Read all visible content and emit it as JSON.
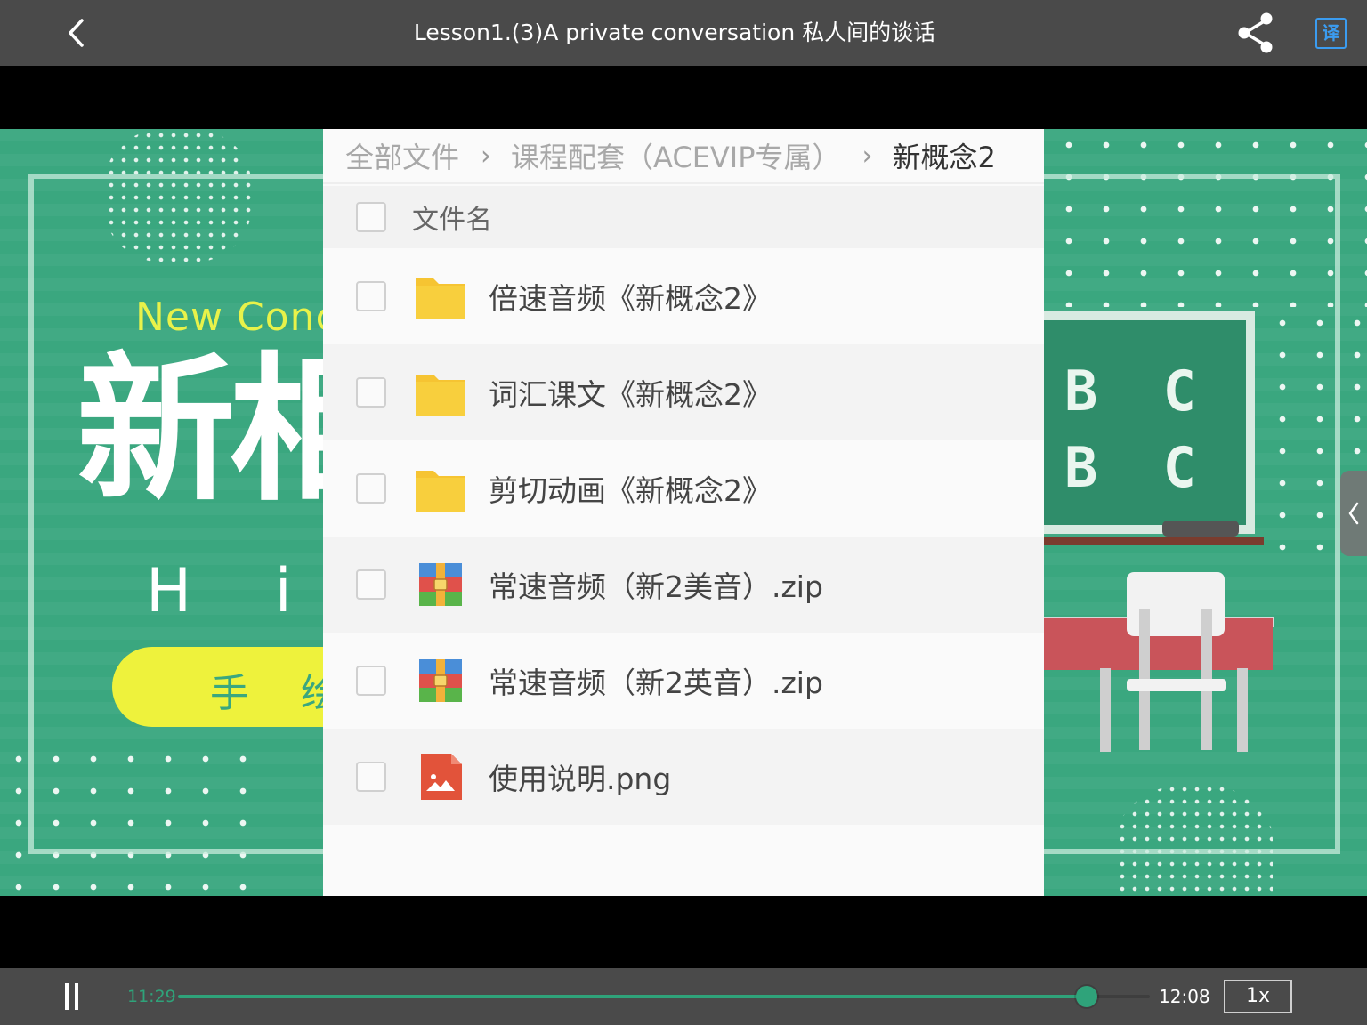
{
  "topbar": {
    "title": "Lesson1.(3)A private conversation 私人间的谈话",
    "back_icon": "chevron-left-icon",
    "share_icon": "share-icon",
    "translate_label": "译"
  },
  "video": {
    "background_color": "#3aa77f",
    "slide_left": {
      "subtitle": "New Conc",
      "title": "新相",
      "greeting": "H i ,",
      "pill_text": "手 绘"
    },
    "slide_right": {
      "board_line_1": "B C",
      "board_line_2": "B C"
    },
    "file_panel": {
      "breadcrumb": [
        {
          "label": "全部文件"
        },
        {
          "label": "课程配套（ACEVIP专属）"
        },
        {
          "label": "新概念2"
        }
      ],
      "header_label": "文件名",
      "files": [
        {
          "name": "倍速音频《新概念2》",
          "icon": "folder-icon"
        },
        {
          "name": "词汇课文《新概念2》",
          "icon": "folder-icon"
        },
        {
          "name": "剪切动画《新概念2》",
          "icon": "folder-icon"
        },
        {
          "name": "常速音频（新2美音）.zip",
          "icon": "zip-archive-icon"
        },
        {
          "name": "常速音频（新2英音）.zip",
          "icon": "zip-archive-icon"
        },
        {
          "name": "使用说明.png",
          "icon": "image-file-icon"
        }
      ]
    },
    "side_handle_icon": "chevron-left-icon"
  },
  "player": {
    "elapsed": "11:29",
    "duration": "12:08",
    "progress_fraction": 0.935,
    "speed_label": "1x",
    "accent_color": "#2fa37a"
  }
}
